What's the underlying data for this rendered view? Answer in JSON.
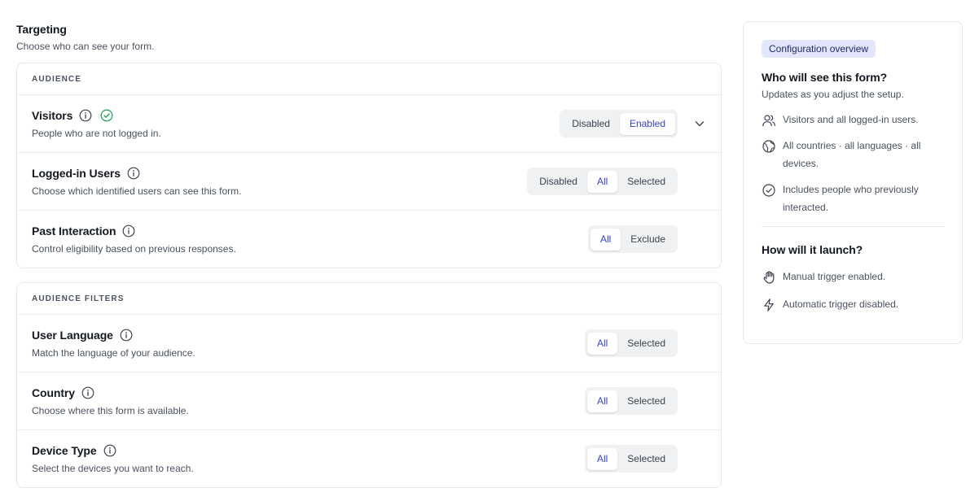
{
  "header": {
    "title": "Targeting",
    "subtitle": "Choose who can see your form."
  },
  "audience": {
    "section_label": "AUDIENCE",
    "rows": [
      {
        "title": "Visitors",
        "description": "People who are not logged in.",
        "options": [
          "Disabled",
          "Enabled"
        ],
        "selected": "Enabled"
      },
      {
        "title": "Logged-in Users",
        "description": "Choose which identified users can see this form.",
        "options": [
          "Disabled",
          "All",
          "Selected"
        ],
        "selected": "All"
      },
      {
        "title": "Past Interaction",
        "description": "Control eligibility based on previous responses.",
        "options": [
          "All",
          "Exclude"
        ],
        "selected": "All"
      }
    ]
  },
  "filters": {
    "section_label": "AUDIENCE FILTERS",
    "rows": [
      {
        "title": "User Language",
        "description": "Match the language of your audience.",
        "options": [
          "All",
          "Selected"
        ],
        "selected": "All"
      },
      {
        "title": "Country",
        "description": "Choose where this form is available.",
        "options": [
          "All",
          "Selected"
        ],
        "selected": "All"
      },
      {
        "title": "Device Type",
        "description": "Select the devices you want to reach.",
        "options": [
          "All",
          "Selected"
        ],
        "selected": "All"
      }
    ]
  },
  "overview": {
    "badge": "Configuration overview",
    "who_title": "Who will see this form?",
    "who_subtitle": "Updates as you adjust the setup.",
    "who_items": [
      {
        "icon": "users-icon",
        "text": "Visitors and all logged-in users."
      },
      {
        "icon": "globe-icon",
        "text": "All countries · all languages · all devices."
      },
      {
        "icon": "check-circle-icon",
        "text": "Includes people who previously interacted."
      }
    ],
    "launch_title": "How will it launch?",
    "launch_items": [
      {
        "icon": "hand-icon",
        "text": "Manual trigger enabled."
      },
      {
        "icon": "lightning-icon",
        "text": "Automatic trigger disabled."
      }
    ]
  },
  "colors": {
    "accent": "#3442d6",
    "success": "#22a45d",
    "badge_bg": "#e3e6fb"
  }
}
